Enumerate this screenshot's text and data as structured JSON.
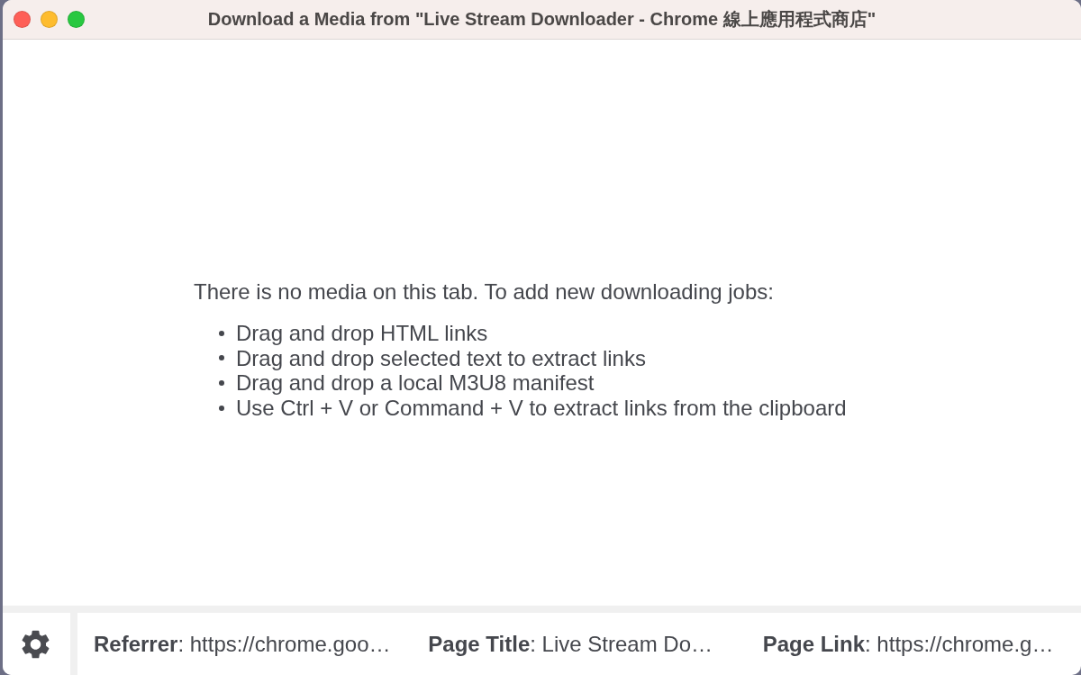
{
  "window": {
    "title": "Download a Media from \"Live Stream Downloader - Chrome 線上應用程式商店\"",
    "controls": [
      {
        "kind": "close"
      },
      {
        "kind": "minimize"
      },
      {
        "kind": "zoom"
      }
    ]
  },
  "empty_state": {
    "message": "There is no media on this tab. To add new downloading jobs:",
    "items": [
      "Drag and drop HTML links",
      "Drag and drop selected text to extract links",
      "Drag and drop a local M3U8 manifest",
      "Use Ctrl + V or Command + V to extract links from the clipboard"
    ]
  },
  "footer": {
    "fields": [
      "**Referrer**: https://chrome.goo…",
      "**Page Title**: Live Stream Do…",
      "**Page Link**: https://chrome.g…"
    ]
  }
}
